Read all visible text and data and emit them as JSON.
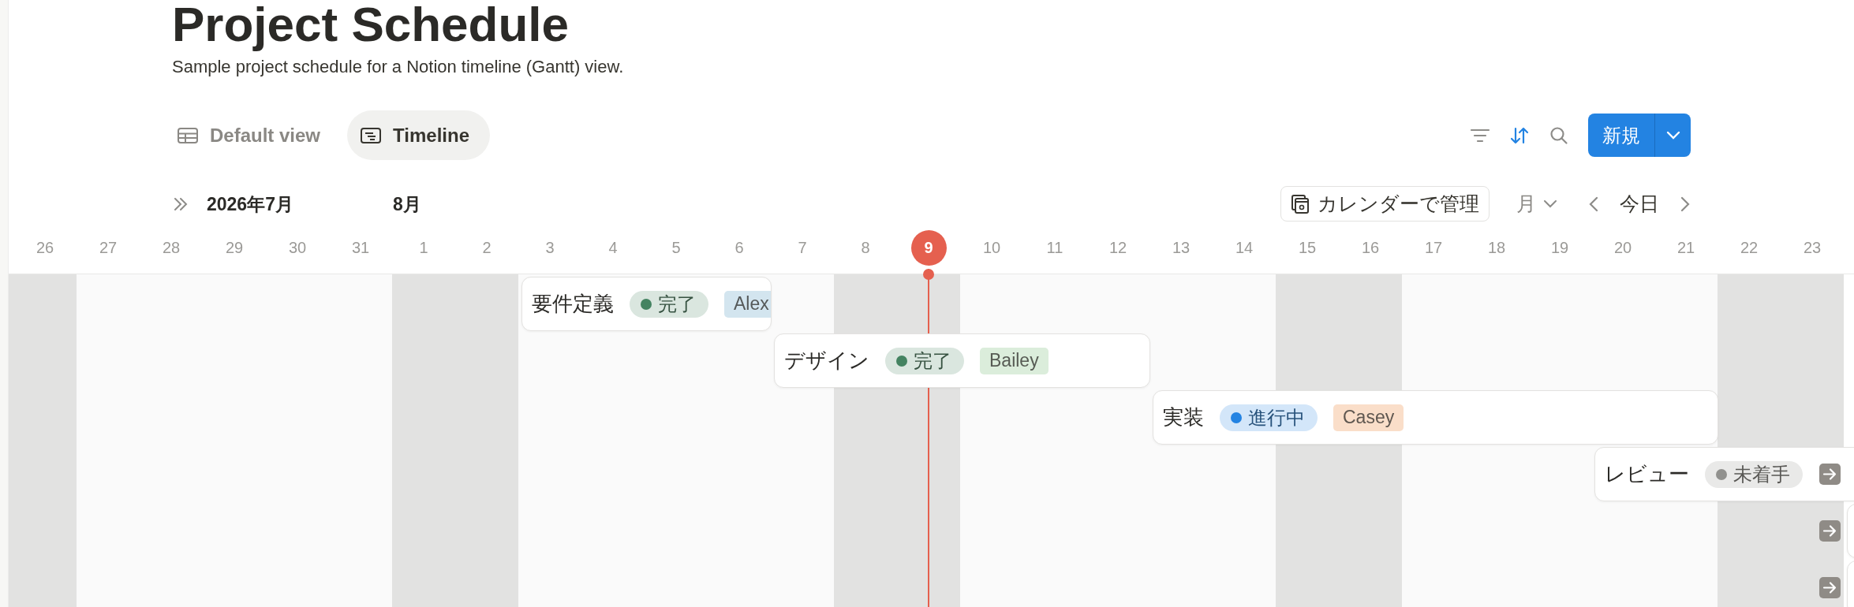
{
  "page": {
    "title": "Project Schedule",
    "description": "Sample project schedule for a Notion timeline (Gantt) view."
  },
  "views": [
    {
      "label": "Default view",
      "kind": "table",
      "selected": false
    },
    {
      "label": "Timeline",
      "kind": "timeline",
      "selected": true
    }
  ],
  "toolbar": {
    "new_button": "新規"
  },
  "timeline": {
    "calendar_button": "カレンダーで管理",
    "zoom": "月",
    "today_button": "今日",
    "days": [
      {
        "label": "26",
        "weekend": true,
        "today": false,
        "month": "2026年7月"
      },
      {
        "label": "27",
        "weekend": false,
        "today": false
      },
      {
        "label": "28",
        "weekend": false,
        "today": false
      },
      {
        "label": "29",
        "weekend": false,
        "today": false
      },
      {
        "label": "30",
        "weekend": false,
        "today": false
      },
      {
        "label": "31",
        "weekend": false,
        "today": false
      },
      {
        "label": "1",
        "weekend": true,
        "today": false,
        "month": "8月"
      },
      {
        "label": "2",
        "weekend": true,
        "today": false
      },
      {
        "label": "3",
        "weekend": false,
        "today": false
      },
      {
        "label": "4",
        "weekend": false,
        "today": false
      },
      {
        "label": "5",
        "weekend": false,
        "today": false
      },
      {
        "label": "6",
        "weekend": false,
        "today": false
      },
      {
        "label": "7",
        "weekend": false,
        "today": false
      },
      {
        "label": "8",
        "weekend": true,
        "today": false
      },
      {
        "label": "9",
        "weekend": true,
        "today": true
      },
      {
        "label": "10",
        "weekend": false,
        "today": false
      },
      {
        "label": "11",
        "weekend": false,
        "today": false
      },
      {
        "label": "12",
        "weekend": false,
        "today": false
      },
      {
        "label": "13",
        "weekend": false,
        "today": false
      },
      {
        "label": "14",
        "weekend": false,
        "today": false
      },
      {
        "label": "15",
        "weekend": true,
        "today": false
      },
      {
        "label": "16",
        "weekend": true,
        "today": false
      },
      {
        "label": "17",
        "weekend": false,
        "today": false
      },
      {
        "label": "18",
        "weekend": false,
        "today": false
      },
      {
        "label": "19",
        "weekend": false,
        "today": false
      },
      {
        "label": "20",
        "weekend": false,
        "today": false
      },
      {
        "label": "21",
        "weekend": false,
        "today": false
      },
      {
        "label": "22",
        "weekend": true,
        "today": false
      },
      {
        "label": "23",
        "weekend": true,
        "today": false
      }
    ],
    "tasks": [
      {
        "title": "要件定義",
        "status": {
          "label": "完了",
          "color": "#448361"
        },
        "assignee": {
          "name": "Alex",
          "color": "#d3e5ef"
        },
        "continues": false
      },
      {
        "title": "デザイン",
        "status": {
          "label": "完了",
          "color": "#448361"
        },
        "assignee": {
          "name": "Bailey",
          "color": "#dbeddb"
        },
        "continues": false
      },
      {
        "title": "実装",
        "status": {
          "label": "進行中",
          "color": "#2383e2"
        },
        "assignee": {
          "name": "Casey",
          "color": "#fadec9"
        },
        "continues": false
      },
      {
        "title": "レビュー",
        "status": {
          "label": "未着手",
          "color": "#91918e"
        },
        "continues": true
      },
      {
        "continues": true
      },
      {
        "continues": true
      }
    ]
  }
}
